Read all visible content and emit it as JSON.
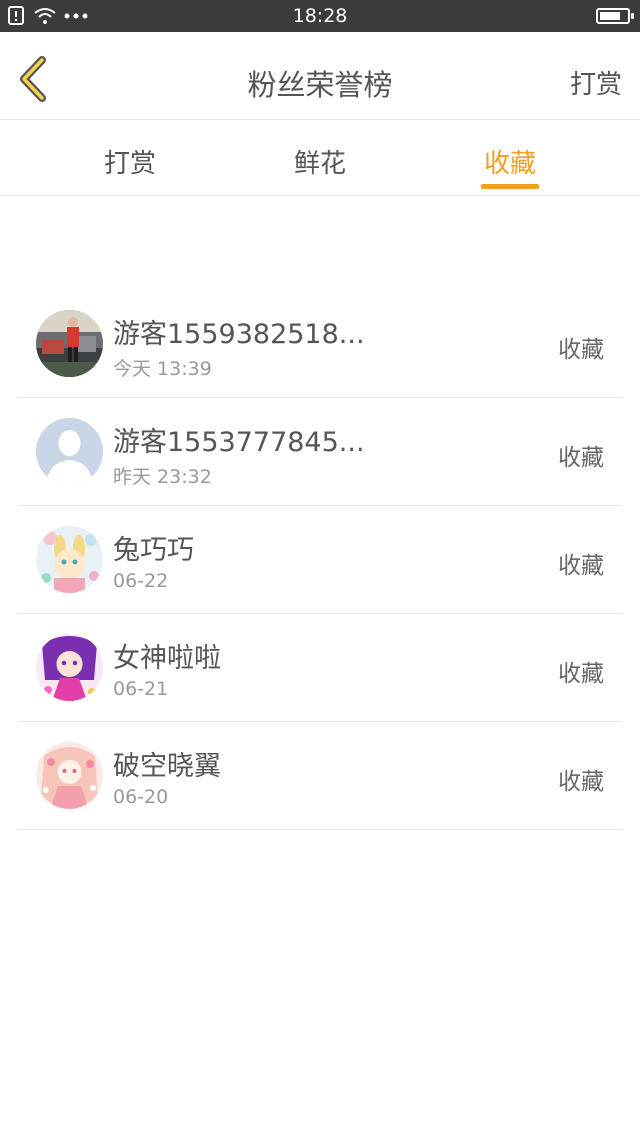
{
  "status_bar": {
    "time": "18:28",
    "icons": [
      "sim-alert-icon",
      "wifi-icon",
      "more-dots-icon"
    ],
    "battery_level": 0.75
  },
  "header": {
    "title": "粉丝荣誉榜",
    "action_label": "打赏",
    "back_icon": "chevron-left-icon",
    "accent_color": "#f0a020"
  },
  "tabs": [
    {
      "label": "打赏",
      "active": false
    },
    {
      "label": "鲜花",
      "active": false
    },
    {
      "label": "收藏",
      "active": true
    }
  ],
  "fans": [
    {
      "name": "游客1559382518...",
      "time": "今天 13:39",
      "action": "收藏",
      "avatar": "photo-avatar"
    },
    {
      "name": "游客1553777845...",
      "time": "昨天 23:32",
      "action": "收藏",
      "avatar": "default-user-icon"
    },
    {
      "name": "兔巧巧",
      "time": "06-22",
      "action": "收藏",
      "avatar": "anime-avatar"
    },
    {
      "name": "女神啦啦",
      "time": "06-21",
      "action": "收藏",
      "avatar": "anime-avatar"
    },
    {
      "name": "破空晓翼",
      "time": "06-20",
      "action": "收藏",
      "avatar": "anime-avatar"
    }
  ]
}
